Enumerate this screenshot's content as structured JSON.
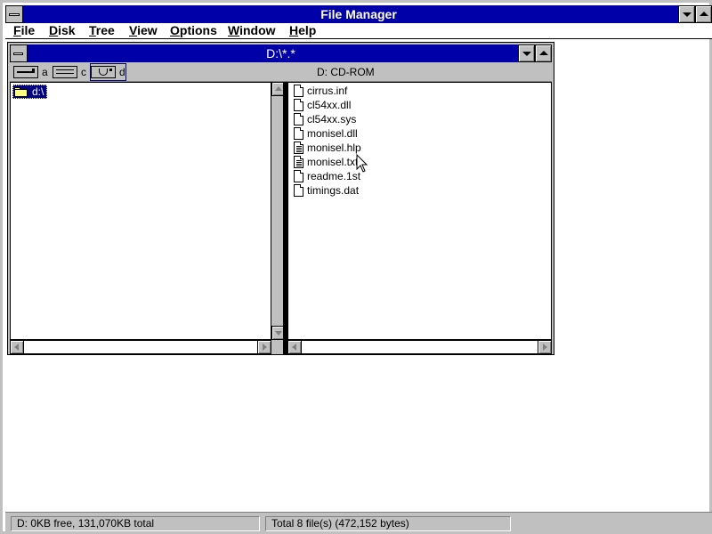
{
  "window": {
    "title": "File Manager"
  },
  "menu": [
    {
      "label": "File",
      "mnemonic": "F",
      "rest": "ile"
    },
    {
      "label": "Disk",
      "mnemonic": "D",
      "rest": "isk"
    },
    {
      "label": "Tree",
      "mnemonic": "T",
      "rest": "ree"
    },
    {
      "label": "View",
      "mnemonic": "V",
      "rest": "iew"
    },
    {
      "label": "Options",
      "mnemonic": "O",
      "rest": "ptions"
    },
    {
      "label": "Window",
      "mnemonic": "W",
      "rest": "indow"
    },
    {
      "label": "Help",
      "mnemonic": "H",
      "rest": "elp"
    }
  ],
  "child": {
    "title": "D:\\*.*",
    "drive_info": "D: CD-ROM",
    "drives": [
      {
        "letter": "a",
        "icon": "floppy-drive-icon",
        "selected": false
      },
      {
        "letter": "c",
        "icon": "hard-drive-icon",
        "selected": false
      },
      {
        "letter": "d",
        "icon": "cdrom-drive-icon",
        "selected": true
      }
    ],
    "tree": {
      "root_label": "d:\\"
    },
    "files": [
      {
        "name": "cirrus.inf",
        "icon": "document-icon"
      },
      {
        "name": "cl54xx.dll",
        "icon": "document-icon"
      },
      {
        "name": "cl54xx.sys",
        "icon": "document-icon"
      },
      {
        "name": "monisel.dll",
        "icon": "document-icon"
      },
      {
        "name": "monisel.hlp",
        "icon": "text-document-icon"
      },
      {
        "name": "monisel.txt",
        "icon": "text-document-icon"
      },
      {
        "name": "readme.1st",
        "icon": "document-icon"
      },
      {
        "name": "timings.dat",
        "icon": "document-icon"
      }
    ]
  },
  "status": {
    "disk": "D: 0KB free,  131,070KB total",
    "files": "Total 8 file(s) (472,152 bytes)"
  },
  "colors": {
    "titlebar": "#0000a8",
    "face": "#c0c0c0",
    "selection": "#000080"
  }
}
